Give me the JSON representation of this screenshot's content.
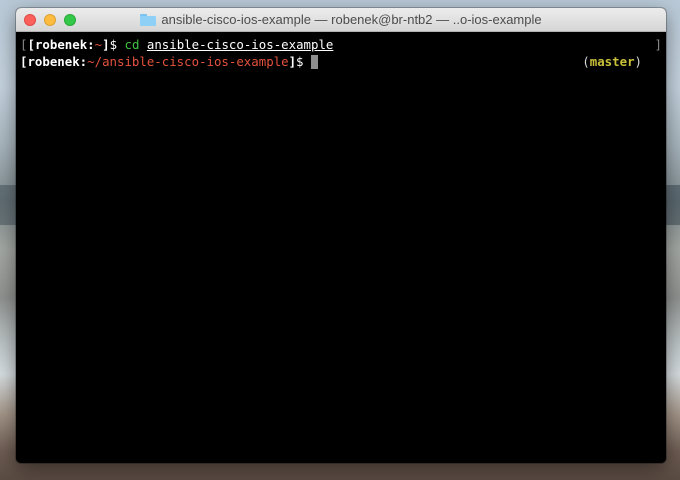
{
  "window": {
    "title": "ansible-cisco-ios-example — robenek@br-ntb2 — ..o-ios-example"
  },
  "terminal": {
    "line1": {
      "edge_left": "[",
      "open": "[",
      "user": "robenek:",
      "path": "~",
      "close": "]",
      "dollar": "$ ",
      "command": "cd",
      "argument": "ansible-cisco-ios-example",
      "edge_right": "]"
    },
    "line2": {
      "open": "[",
      "user": "robenek:",
      "path": "~/ansible-cisco-ios-example",
      "close": "]",
      "dollar": "$ ",
      "rprompt_open": "(",
      "branch": "master",
      "rprompt_close": ")"
    }
  },
  "icons": {
    "title_icon": "folder-icon",
    "window_controls": [
      "close",
      "minimize",
      "zoom"
    ]
  },
  "colors": {
    "prompt_path": "#e3523d",
    "command": "#3fc13f",
    "branch": "#c9c03a",
    "background": "#000000"
  }
}
